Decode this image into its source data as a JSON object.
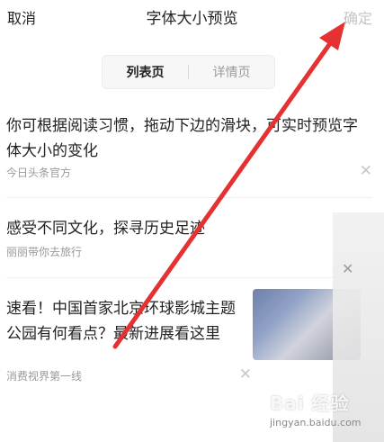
{
  "header": {
    "cancel_label": "取消",
    "title": "字体大小预览",
    "confirm_label": "确定"
  },
  "tabs": [
    {
      "label": "列表页",
      "active": true
    },
    {
      "label": "详情页",
      "active": false
    }
  ],
  "feed": [
    {
      "title": "你可根据阅读习惯，拖动下边的滑块，可实时预览字\n体大小的变化",
      "source": "今日头条官方"
    },
    {
      "title": "感受不同文化，探寻历史足迹",
      "source": "丽丽带你去旅行"
    },
    {
      "title": "速看！中国首家北京环球影城主题\n公园有何看点？最新进展看这里",
      "source": "消费视界第一线"
    }
  ],
  "watermark": {
    "text": "Bai 经验",
    "sub": "jingyan.baidu.com"
  },
  "colors": {
    "arrow": "#e53131",
    "confirm_disabled": "#c4c4c4"
  }
}
